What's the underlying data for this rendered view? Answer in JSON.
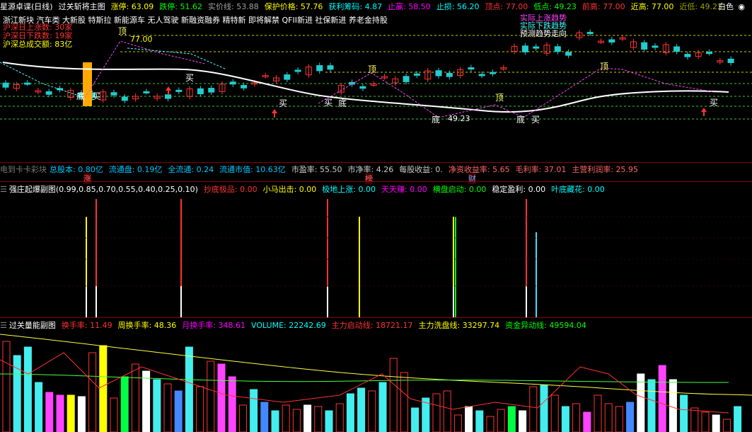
{
  "header": {
    "app_name": "星源卓谍(日线)",
    "indicator_name": "过关斩将主图",
    "items": [
      {
        "label": "涨停: 63.09",
        "color": "#ffff00"
      },
      {
        "label": "跌停: 51.62",
        "color": "#00ff00"
      },
      {
        "label": "实价线: 53.88",
        "color": "#a0a0a0"
      },
      {
        "label": "保护价格: 57.76",
        "color": "#ffff00"
      },
      {
        "label": "获利筹码: 4.87",
        "color": "#00ffff"
      },
      {
        "label": "止赢: 58.50",
        "color": "#ff00ff"
      },
      {
        "label": "止损: 56.20",
        "color": "#00ffff"
      },
      {
        "label": "顶点: 77.00",
        "color": "#ff3333"
      },
      {
        "label": "低点: 49.23",
        "color": "#00ff00"
      },
      {
        "label": "前高: 77.00",
        "color": "#ff3333"
      },
      {
        "label": "近高: 77.00",
        "color": "#ffff00"
      },
      {
        "label": "近低: 49.23",
        "color": "#a0a000"
      }
    ],
    "theme_label": "白色"
  },
  "news_line": "浙江新块 汽车类 大新股 特斯拉 新能源车 无人驾驶 新融资融券 精特新 即将解禁 QFII新进 社保新进 养老金持股",
  "overlay_legend": [
    {
      "label": "沪深日上涨数: 30家",
      "color": "#ff3333"
    },
    {
      "label": "沪深日下跌数: 19家",
      "color": "#ff3333"
    },
    {
      "label": "沪深总成交额: 83亿",
      "color": "#ffff00"
    }
  ],
  "trend_legend": [
    {
      "label": "实际上涨趋势",
      "color": "#ff44ff"
    },
    {
      "label": "实际下跌趋势",
      "color": "#44ffff"
    },
    {
      "label": "预测趋势走向",
      "color": "#ffffff"
    }
  ],
  "chart_tags": {
    "peak_value": "77.00",
    "low_value": "49.23",
    "ding": "顶",
    "di": "底",
    "buy": "买"
  },
  "fin_bar": {
    "first": "电到卡卡彩块",
    "items": [
      {
        "label": "总股本: 0.80亿",
        "color": "#00c8ff"
      },
      {
        "label": "流通盘: 0.19亿",
        "color": "#00c8ff"
      },
      {
        "label": "全流通: 0.24",
        "color": "#00c8ff"
      },
      {
        "label": "流通市值: 10.63亿",
        "color": "#00c8ff"
      },
      {
        "label": "市盈率: 55.50",
        "color": "#cccccc"
      },
      {
        "label": "市净率: 4.26",
        "color": "#cccccc"
      },
      {
        "label": "每股收益: 0.",
        "color": "#cccccc"
      },
      {
        "label": "净资收益率: 5.65",
        "color": "#ff6666"
      },
      {
        "label": "毛利率: 37.01",
        "color": "#ff6666"
      },
      {
        "label": "主营利润率: 25.95",
        "color": "#ff6666"
      }
    ],
    "markers": [
      "涨",
      "榜",
      "财"
    ]
  },
  "sub1": {
    "name": "强庄起爆副图",
    "params": "(0.99,0.85,0.70,0.55,0.40,0.25,0.10)",
    "items": [
      {
        "label": "抄底极品: 0.00",
        "color": "#ff3333"
      },
      {
        "label": "小马出击: 0.00",
        "color": "#ffff00"
      },
      {
        "label": "极地上涨: 0.00",
        "color": "#00ffff"
      },
      {
        "label": "天天赚: 0.00",
        "color": "#ff00ff"
      },
      {
        "label": "横盘启动: 0.00",
        "color": "#00ff00"
      },
      {
        "label": "稳定盈利: 0.00",
        "color": "#ffffff"
      },
      {
        "label": "叶底藏花: 0.00",
        "color": "#00ffff"
      }
    ]
  },
  "sub2": {
    "name": "过关量能副图",
    "items": [
      {
        "label": "换手率: 11.49",
        "color": "#ff3333"
      },
      {
        "label": "周换手率: 48.36",
        "color": "#ffff00"
      },
      {
        "label": "月换手率: 348.61",
        "color": "#ff00ff"
      },
      {
        "label": "VOLUME: 22242.69",
        "color": "#00ffff"
      },
      {
        "label": "主力启动线: 18721.17",
        "color": "#ff3333"
      },
      {
        "label": "主力洗盘线: 33297.74",
        "color": "#ffff00"
      },
      {
        "label": "资金异动线: 49594.04",
        "color": "#00ff00"
      }
    ]
  }
}
